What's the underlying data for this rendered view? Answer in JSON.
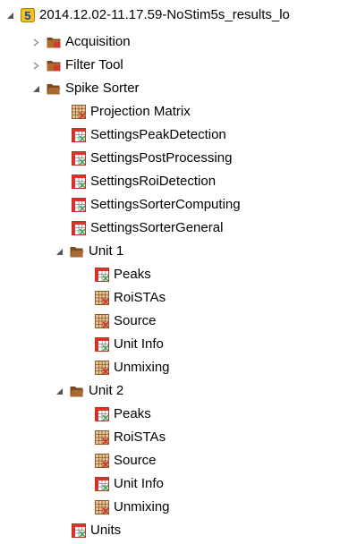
{
  "root": {
    "label": "2014.12.02-11.17.59-NoStim5s_results_lo",
    "badge": "5",
    "icon": "project-icon"
  },
  "acquisition": {
    "label": "Acquisition",
    "icon": "closed-folder-icon"
  },
  "filter_tool": {
    "label": "Filter Tool",
    "icon": "closed-folder-icon"
  },
  "spike_sorter": {
    "label": "Spike Sorter",
    "icon": "open-folder-icon",
    "items": [
      {
        "label": "Projection Matrix",
        "icon": "matrix-icon"
      },
      {
        "label": "SettingsPeakDetection",
        "icon": "table-icon"
      },
      {
        "label": "SettingsPostProcessing",
        "icon": "table-icon"
      },
      {
        "label": "SettingsRoiDetection",
        "icon": "table-icon"
      },
      {
        "label": "SettingsSorterComputing",
        "icon": "table-icon"
      },
      {
        "label": "SettingsSorterGeneral",
        "icon": "table-icon"
      }
    ],
    "unit1": {
      "label": "Unit 1",
      "icon": "open-folder-icon",
      "items": [
        {
          "label": "Peaks",
          "icon": "table-icon"
        },
        {
          "label": "RoiSTAs",
          "icon": "matrix-icon"
        },
        {
          "label": "Source",
          "icon": "matrix-icon"
        },
        {
          "label": "Unit Info",
          "icon": "table-icon"
        },
        {
          "label": "Unmixing",
          "icon": "matrix-icon"
        }
      ]
    },
    "unit2": {
      "label": "Unit 2",
      "icon": "open-folder-icon",
      "items": [
        {
          "label": "Peaks",
          "icon": "table-icon"
        },
        {
          "label": "RoiSTAs",
          "icon": "matrix-icon"
        },
        {
          "label": "Source",
          "icon": "matrix-icon"
        },
        {
          "label": "Unit Info",
          "icon": "table-icon"
        },
        {
          "label": "Unmixing",
          "icon": "matrix-icon"
        }
      ]
    },
    "units": {
      "label": "Units",
      "icon": "table-icon"
    }
  },
  "colors": {
    "badge_bg": "#f3c21b",
    "badge_text": "#1d3fa8",
    "folder": "#7a4a1e",
    "folder_red": "#d33b2c",
    "table_red": "#d8332a",
    "table_green": "#2fa552",
    "matrix_brown": "#b27a45",
    "twisty": "#6b6b6b"
  }
}
